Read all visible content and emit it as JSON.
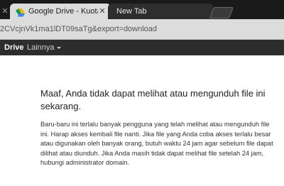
{
  "browser": {
    "tabs": [
      {
        "title": "Google Drive - Kuota ter",
        "active": true
      },
      {
        "title": "New Tab",
        "active": false
      }
    ],
    "address": "2CVcjnVk1ma1lDT09saTg&export=download"
  },
  "nav": {
    "drive_label": "Drive",
    "more_label": "Lainnya"
  },
  "main": {
    "heading": "Maaf, Anda tidak dapat melihat atau mengunduh file ini sekarang.",
    "message": "Baru-baru ini terlalu banyak pengguna yang telah melihat atau mengunduh file ini. Harap akses kembali file nanti. Jika file yang Anda coba akses terlalu besar atau digunakan oleh banyak orang, butuh waktu 24 jam agar sebelum file dapat dilihat atau diunduh. Jika Anda masih tidak dapat melihat file setelah 24 jam, hubungi administrator domain."
  },
  "colors": {
    "tabstrip": "#1a1a1a",
    "active_tab": "#dcdcdc",
    "navbar": "#2d2d2d"
  }
}
